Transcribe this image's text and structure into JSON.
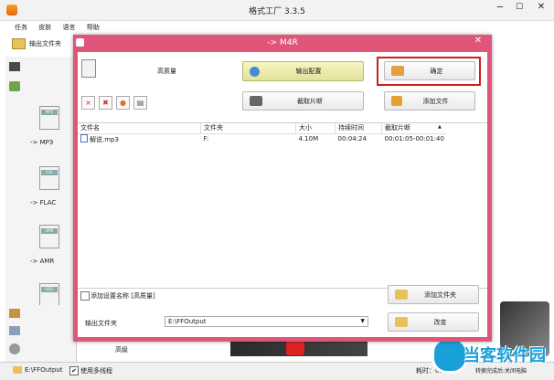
{
  "app": {
    "title": "格式工厂 3.3.5",
    "menu": [
      "任务",
      "皮肤",
      "语言",
      "帮助"
    ],
    "toolbar_output_label": "输出文件夹",
    "sidebar_bottom_label": "高级",
    "status_path": "E:\\FFOutput",
    "status_multithread_label": "使用多线程",
    "status_elapsed": "耗时：00",
    "status_shutdown": "转换完成后:关闭电脑",
    "sidebar_items": [
      {
        "label": "-> MP3",
        "tag": "MP3"
      },
      {
        "label": "-> FLAC",
        "tag": "FLA"
      },
      {
        "label": "-> AMR",
        "tag": "AMR"
      },
      {
        "label": "",
        "tag": "OGG"
      }
    ]
  },
  "dialog": {
    "title": "-> M4R",
    "quality": "高质量",
    "output_config_label": "输出配置",
    "ok_label": "确定",
    "clip_label": "截取片断",
    "add_file_label": "添加文件",
    "columns": [
      "文件名",
      "文件夹",
      "大小",
      "持续时间",
      "截取片断"
    ],
    "files": [
      {
        "name": "解说.mp3",
        "folder": "F:",
        "size": "4.10M",
        "duration": "00:04:24",
        "clip": "00:01:05-00:01:40"
      }
    ],
    "add_setting_name_label": "添加设置名称 [高质量]",
    "add_folder_label": "添加文件夹",
    "output_folder_label": "输出文件夹",
    "output_folder_value": "E:\\FFOutput",
    "change_label": "改变"
  },
  "watermark": "当客软件园",
  "colors": {
    "accent": "#e0567a",
    "highlight": "#cc1f1f",
    "brand": "#1aa0d8"
  }
}
